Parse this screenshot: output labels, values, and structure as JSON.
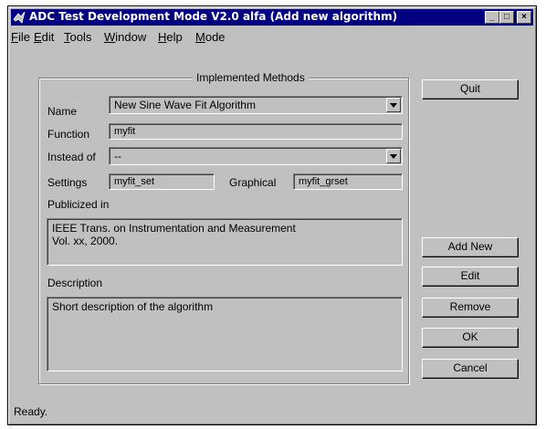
{
  "window": {
    "title": "ADC Test Development Mode V2.0 alfa (Add new algorithm)"
  },
  "menu": [
    {
      "label": "File",
      "accel": "F",
      "rest": "ile"
    },
    {
      "label": "Edit",
      "accel": "E",
      "rest": "dit"
    },
    {
      "label": "Tools",
      "accel": "T",
      "rest": "ools"
    },
    {
      "label": "Window",
      "accel": "W",
      "rest": "indow"
    },
    {
      "label": "Help",
      "accel": "H",
      "rest": "elp"
    },
    {
      "label": "Mode",
      "accel": "M",
      "rest": "ode"
    }
  ],
  "group": {
    "title": "Implemented Methods",
    "name_label": "Name",
    "name_value": "New Sine Wave Fit Algorithm",
    "function_label": "Function",
    "function_value": "myfit",
    "insteadof_label": "Instead of",
    "insteadof_value": "--",
    "settings_label": "Settings",
    "settings_value": "myfit_set",
    "graphical_label": "Graphical",
    "graphical_value": "myfit_grset",
    "publicized_label": "Publicized in",
    "publicized_line1": "IEEE Trans. on Instrumentation and Measurement",
    "publicized_line2": "Vol. xx, 2000.",
    "description_label": "Description",
    "description_value": "Short description of the algorithm"
  },
  "buttons": {
    "quit": "Quit",
    "add_new": "Add New",
    "edit": "Edit",
    "remove": "Remove",
    "ok": "OK",
    "cancel": "Cancel"
  },
  "status": "Ready."
}
